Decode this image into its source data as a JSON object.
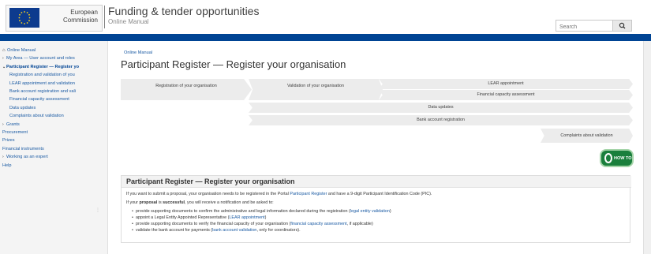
{
  "header": {
    "logo_line1": "European",
    "logo_line2": "Commission",
    "title": "Funding & tender opportunities",
    "subtitle": "Online Manual",
    "search_placeholder": "Search",
    "search_icon": "search-icon"
  },
  "sidebar": {
    "items": [
      {
        "label": "Online Manual",
        "icon": "home-icon"
      },
      {
        "label": "My Area — User account and roles",
        "icon": "chevron-right-icon"
      },
      {
        "label": "Participant Register — Register yo",
        "icon": "chevron-down-icon"
      },
      {
        "label": "Registration and validation of you"
      },
      {
        "label": "LEAR appointment and validation"
      },
      {
        "label": "Bank account registration and vali"
      },
      {
        "label": "Financial capacity assessment"
      },
      {
        "label": "Data updates"
      },
      {
        "label": "Complaints about validation"
      },
      {
        "label": "Grants",
        "icon": "chevron-right-icon"
      },
      {
        "label": "Procurement"
      },
      {
        "label": "Prizes"
      },
      {
        "label": "Financial instruments"
      },
      {
        "label": "Working as an expert",
        "icon": "chevron-right-icon"
      },
      {
        "label": "Help"
      }
    ]
  },
  "main": {
    "breadcrumb": "Online Manual",
    "title": "Participant Register — Register your organisation",
    "steps": {
      "s1": "Registration of your organisation",
      "s2": "Validation of your organisation",
      "s3": "LEAR appointment",
      "s4": "Financial capacity assessment",
      "s5": "Data updates",
      "s6": "Bank account registration",
      "s7": "Complaints about validation"
    },
    "howto_label": "HOW TO",
    "content": {
      "title": "Participant Register — Register your organisation",
      "p1_a": "If you want to submit a proposal, your organisation needs to be registered in the Portal ",
      "p1_link": "Participant Register",
      "p1_b": " and have a 9-digit Participant Identification Code (PIC).",
      "p2_a": "If your ",
      "p2_bold": "proposal",
      "p2_b": " is ",
      "p2_bold2": "successful",
      "p2_c": ", you will receive a notification and be asked to:",
      "bullets": [
        {
          "text": "provide supporting documents to confirm the administrative and legal information declared during the registration (",
          "link": "legal entity validation",
          "after": ")"
        },
        {
          "text": "appoint a Legal Entity Appointed Representative (",
          "link": "LEAR appointment",
          "after": ")"
        },
        {
          "text": "provide supporting documents to verify the financial capacity of your organisation (",
          "link": "financial capacity assessment",
          "after": ", if applicable)"
        },
        {
          "text": "validate the bank account for payments (",
          "link": "bank account validation",
          "after": ", only for coordinators)."
        }
      ]
    }
  },
  "colors": {
    "brand_blue": "#004494",
    "link": "#1a5aa3",
    "howto_green": "#1a7f3c"
  }
}
